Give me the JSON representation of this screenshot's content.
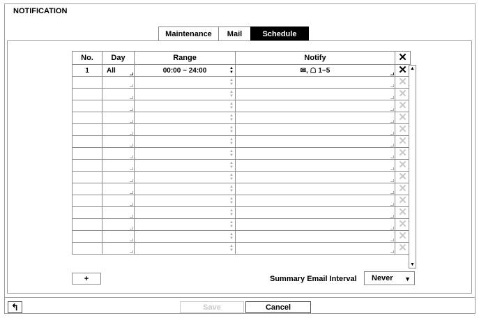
{
  "window": {
    "title": "NOTIFICATION"
  },
  "tabs": [
    {
      "label": "Maintenance",
      "active": false
    },
    {
      "label": "Mail",
      "active": false
    },
    {
      "label": "Schedule",
      "active": true
    }
  ],
  "table": {
    "headers": {
      "no": "No.",
      "day": "Day",
      "range": "Range",
      "notify": "Notify",
      "delete_all_icon": "close-icon"
    },
    "rows": [
      {
        "no": "1",
        "day": "All",
        "range": "00:00 ~ 24:00",
        "notify": "✉, ☖ 1~5"
      },
      {
        "no": "",
        "day": "",
        "range": "",
        "notify": ""
      },
      {
        "no": "",
        "day": "",
        "range": "",
        "notify": ""
      },
      {
        "no": "",
        "day": "",
        "range": "",
        "notify": ""
      },
      {
        "no": "",
        "day": "",
        "range": "",
        "notify": ""
      },
      {
        "no": "",
        "day": "",
        "range": "",
        "notify": ""
      },
      {
        "no": "",
        "day": "",
        "range": "",
        "notify": ""
      },
      {
        "no": "",
        "day": "",
        "range": "",
        "notify": ""
      },
      {
        "no": "",
        "day": "",
        "range": "",
        "notify": ""
      },
      {
        "no": "",
        "day": "",
        "range": "",
        "notify": ""
      },
      {
        "no": "",
        "day": "",
        "range": "",
        "notify": ""
      },
      {
        "no": "",
        "day": "",
        "range": "",
        "notify": ""
      },
      {
        "no": "",
        "day": "",
        "range": "",
        "notify": ""
      },
      {
        "no": "",
        "day": "",
        "range": "",
        "notify": ""
      },
      {
        "no": "",
        "day": "",
        "range": "",
        "notify": ""
      },
      {
        "no": "",
        "day": "",
        "range": "",
        "notify": ""
      }
    ]
  },
  "add_button": {
    "label": "+"
  },
  "summary_interval": {
    "label": "Summary Email Interval",
    "value": "Never"
  },
  "footer": {
    "save_label": "Save",
    "cancel_label": "Cancel",
    "back_icon": "back-arrow-icon"
  },
  "colors": {
    "active_tab_bg": "#000000",
    "border": "#8a8a8a",
    "disabled": "#c8c8c8"
  }
}
